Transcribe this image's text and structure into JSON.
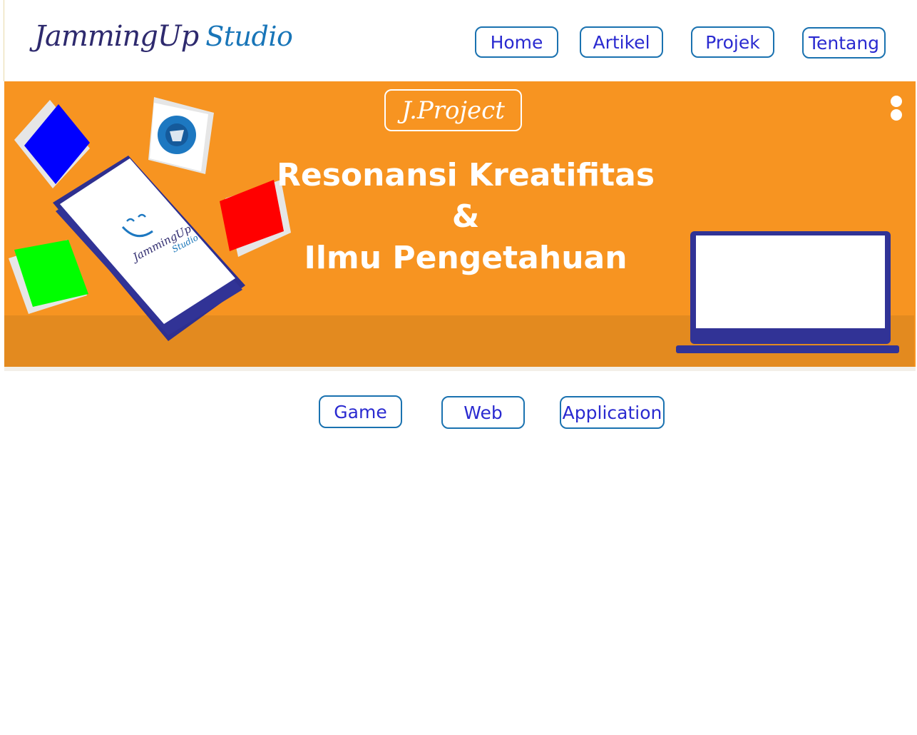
{
  "header": {
    "logo_main": "JammingUp",
    "logo_sub": "Studio",
    "nav": [
      {
        "label": "Home"
      },
      {
        "label": "Artikel"
      },
      {
        "label": "Projek"
      },
      {
        "label": "Tentang"
      }
    ]
  },
  "banner": {
    "badge": "J.Project",
    "headline_1": "Resonansi Kreatifitas",
    "headline_2": "&",
    "headline_3": "Ilmu Pengetahuan",
    "phone_logo_main": "JammingUp",
    "phone_logo_sub": "Studio",
    "menu_icon": "kebab-menu-icon",
    "colors": {
      "banner": "#f79421",
      "floor": "#e38a1f",
      "tile_blue": "#0000ff",
      "tile_red": "#ff0000",
      "tile_green": "#00ff00",
      "device": "#313396"
    }
  },
  "categories": [
    {
      "label": "Game"
    },
    {
      "label": "Web"
    },
    {
      "label": "Application"
    }
  ]
}
